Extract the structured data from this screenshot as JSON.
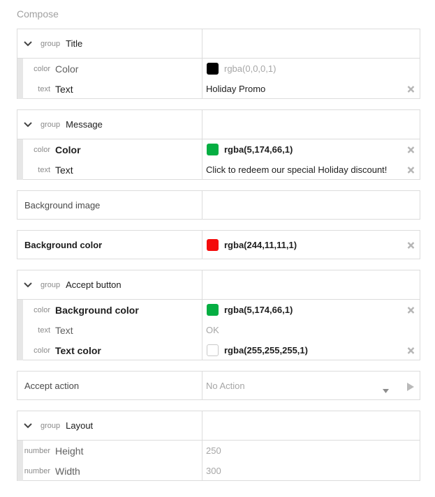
{
  "compose_title": "Compose",
  "groups": {
    "title": {
      "tag": "group",
      "label": "Title",
      "children": [
        {
          "type": "color",
          "label": "Color",
          "value": "rgba(0,0,0,1)",
          "swatch": "#000000"
        },
        {
          "type": "text",
          "label": "Text",
          "value": "Holiday Promo"
        }
      ]
    },
    "message": {
      "tag": "group",
      "label": "Message",
      "children": [
        {
          "type": "color",
          "label": "Color",
          "value": "rgba(5,174,66,1)",
          "swatch": "#05ae42"
        },
        {
          "type": "text",
          "label": "Text",
          "value": "Click to redeem our special Holiday discount!"
        }
      ]
    },
    "accept_button": {
      "tag": "group",
      "label": "Accept button",
      "children": [
        {
          "type": "color",
          "label": "Background color",
          "value": "rgba(5,174,66,1)",
          "swatch": "#05ae42"
        },
        {
          "type": "text",
          "label": "Text",
          "value": "",
          "placeholder": "OK"
        },
        {
          "type": "color",
          "label": "Text color",
          "value": "rgba(255,255,255,1)",
          "swatch": "#ffffff"
        }
      ]
    },
    "layout": {
      "tag": "group",
      "label": "Layout",
      "children": [
        {
          "type": "number",
          "label": "Height",
          "placeholder": "250"
        },
        {
          "type": "number",
          "label": "Width",
          "placeholder": "300"
        }
      ]
    }
  },
  "background_image": {
    "label": "Background image",
    "value": ""
  },
  "background_color": {
    "label": "Background color",
    "value": "rgba(244,11,11,1)",
    "swatch": "#f40b0b"
  },
  "accept_action": {
    "label": "Accept action",
    "value": "No Action"
  },
  "icons": {
    "chevron": "chevron-down-icon",
    "clear": "close-icon",
    "caret": "caret-down-icon",
    "play": "play-icon"
  }
}
